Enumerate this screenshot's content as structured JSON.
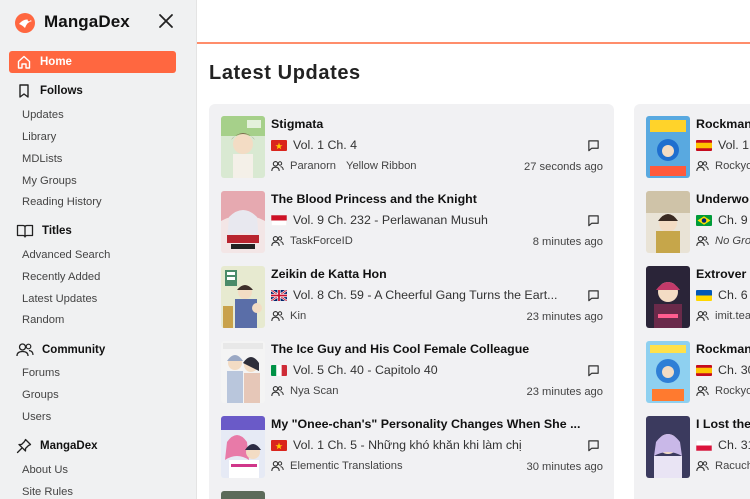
{
  "brand": {
    "name": "MangaDex"
  },
  "sidebar": {
    "home": "Home",
    "follows": {
      "label": "Follows",
      "items": [
        "Updates",
        "Library",
        "MDLists",
        "My Groups",
        "Reading History"
      ]
    },
    "titles": {
      "label": "Titles",
      "items": [
        "Advanced Search",
        "Recently Added",
        "Latest Updates",
        "Random"
      ]
    },
    "community": {
      "label": "Community",
      "items": [
        "Forums",
        "Groups",
        "Users"
      ]
    },
    "mangadex": {
      "label": "MangaDex",
      "items": [
        "About Us",
        "Site Rules"
      ]
    }
  },
  "main": {
    "title": "Latest Updates",
    "col1": [
      {
        "title": "Stigmata",
        "chapter": "Vol. 1 Ch. 4",
        "flag": "vietnam",
        "group": "Paranorn",
        "group2": "Yellow Ribbon",
        "time": "27 seconds ago"
      },
      {
        "title": "The Blood Princess and the Knight",
        "chapter": "Vol. 9 Ch. 232 - Perlawanan Musuh",
        "flag": "indonesia",
        "group": "TaskForceID",
        "group2": "",
        "time": "8 minutes ago"
      },
      {
        "title": "Zeikin de Katta Hon",
        "chapter": "Vol. 8 Ch. 59 - A Cheerful Gang Turns the Eart...",
        "flag": "uk",
        "group": "Kin",
        "group2": "",
        "time": "23 minutes ago"
      },
      {
        "title": "The Ice Guy and His Cool Female Colleague",
        "chapter": "Vol. 5 Ch. 40 - Capitolo 40",
        "flag": "italy",
        "group": "Nya Scan",
        "group2": "",
        "time": "23 minutes ago"
      },
      {
        "title": "My \"Onee-chan's\" Personality Changes When She ...",
        "chapter": "Vol. 1 Ch. 5 - Những khó khăn khi làm chị",
        "flag": "vietnam",
        "group": "Elementic Translations",
        "group2": "",
        "time": "30 minutes ago"
      }
    ],
    "col2": [
      {
        "title": "Rockman",
        "chapter": "Vol. 1",
        "flag": "spain",
        "group": "Rockyo"
      },
      {
        "title": "Underwo",
        "chapter": "Ch. 9",
        "flag": "brazil",
        "group": "No Gro"
      },
      {
        "title": "Extrover",
        "chapter": "Ch. 6",
        "flag": "ukraine",
        "group": "imit.tea"
      },
      {
        "title": "Rockman",
        "chapter": "Ch. 30",
        "flag": "spain",
        "group": "Rockyo"
      },
      {
        "title": "I Lost the",
        "chapter": "Ch. 31",
        "flag": "poland",
        "group": "Racuch"
      }
    ]
  },
  "colors": {
    "accent": "#ff6740",
    "sidebar_bg": "#f0f1f2",
    "card_bg": "#f1f1f3"
  },
  "icons": [
    "mangadex-logo",
    "close-icon",
    "home-icon",
    "bookmark-icon",
    "book-icon",
    "users-icon",
    "pin-icon",
    "comment-icon",
    "user-group-icon"
  ]
}
